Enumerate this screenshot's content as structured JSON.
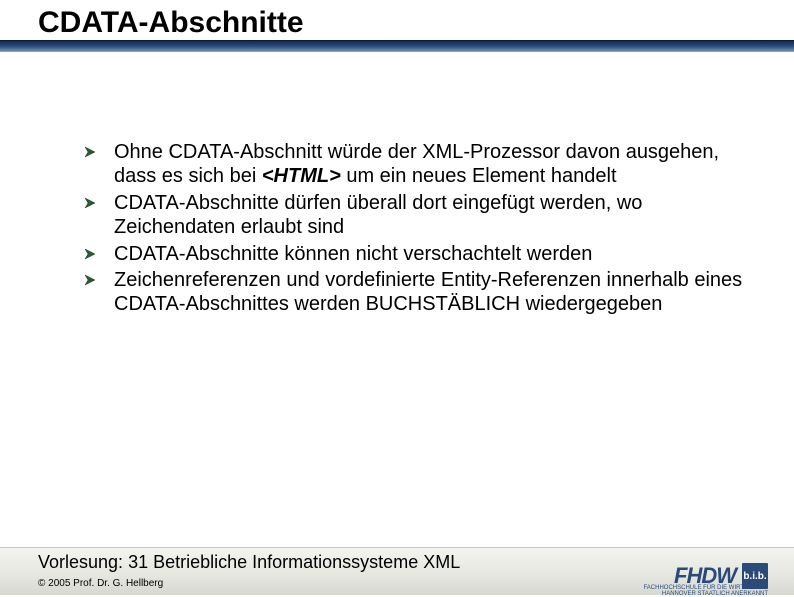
{
  "title": "CDATA-Abschnitte",
  "bullets": [
    {
      "pre": "Ohne CDATA-Abschnitt würde der XML-Prozessor davon ausgehen, dass es sich bei ",
      "strong": "<HTML>",
      "post": " um ein neues Element handelt"
    },
    {
      "pre": "CDATA-Abschnitte dürfen überall dort eingefügt werden, wo Zeichendaten erlaubt sind",
      "strong": "",
      "post": ""
    },
    {
      "pre": "CDATA-Abschnitte können nicht verschachtelt werden",
      "strong": "",
      "post": ""
    },
    {
      "pre": "Zeichenreferenzen und vordefinierte Entity-Referenzen innerhalb eines CDATA-Abschnittes werden BUCHSTÄBLICH wiedergegeben",
      "strong": "",
      "post": ""
    }
  ],
  "footer": {
    "lecture_label": "Vorlesung:",
    "lecture_value": " 31 Betriebliche Informationssysteme XML",
    "copyright": "© 2005 Prof. Dr. G. Hellberg"
  },
  "logo": {
    "main": "FHDW",
    "badge": "b.i.b.",
    "sub1": "FACHHOCHSCHULE FÜR DIE WIRTSCHAFT",
    "sub2": "HANNOVER   STAATLICH ANERKANNT"
  },
  "colors": {
    "brand_blue": "#2a4a7a"
  }
}
